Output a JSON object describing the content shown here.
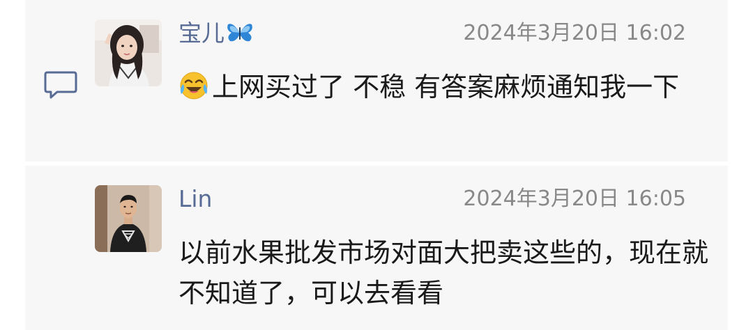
{
  "comments": [
    {
      "author": "宝儿",
      "author_badge_icon": "butterfly-icon",
      "time": "2024年3月20日 16:02",
      "emoji_icon": "crying-laughing-emoji-icon",
      "text": "上网买过了 不稳 有答案麻烦通知我一下"
    },
    {
      "author": "Lin",
      "time": "2024年3月20日 16:05",
      "text": "以前水果批发市场对面大把卖这些的，现在就不知道了，可以去看看"
    }
  ],
  "colors": {
    "author": "#576b95",
    "time": "#888888",
    "panel": "#f7f7f7",
    "text": "#1a1a1a"
  },
  "section_icon": "comment-icon"
}
